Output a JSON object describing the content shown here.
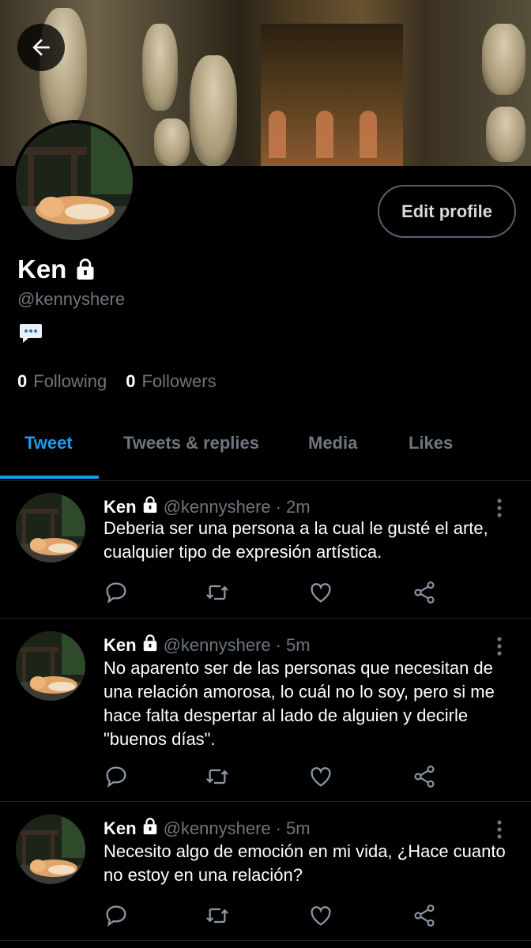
{
  "profile": {
    "name": "Ken",
    "handle": "@kennyshere",
    "edit_label": "Edit profile",
    "following_count": "0",
    "following_label": "Following",
    "followers_count": "0",
    "followers_label": "Followers"
  },
  "tabs": [
    {
      "label": "Tweet",
      "active": true
    },
    {
      "label": "Tweets & replies",
      "active": false
    },
    {
      "label": "Media",
      "active": false
    },
    {
      "label": "Likes",
      "active": false
    }
  ],
  "tweets": [
    {
      "name": "Ken",
      "handle": "@kennyshere",
      "sep": "·",
      "time": "2m",
      "text": "Deberia ser una persona a la cual le gusté el arte, cualquier tipo de expresión artística."
    },
    {
      "name": "Ken",
      "handle": "@kennyshere",
      "sep": "·",
      "time": "5m",
      "text": "No aparento ser de las personas que necesitan de una relación amorosa, lo cuál no lo soy, pero si me hace falta despertar al lado de alguien y decirle \"buenos días\"."
    },
    {
      "name": "Ken",
      "handle": "@kennyshere",
      "sep": "·",
      "time": "5m",
      "text": "Necesito algo de emoción en mi vida, ¿Hace cuanto no estoy en una relación?"
    }
  ],
  "icons": {
    "back": "arrow-left-icon",
    "lock": "lock-icon",
    "bio": "speech-bubble-emoji",
    "reply": "reply-icon",
    "retweet": "retweet-icon",
    "like": "heart-icon",
    "share": "share-icon",
    "more": "more-vertical-icon"
  },
  "colors": {
    "accent": "#1d9bf0",
    "muted": "#6e767d",
    "background": "#000000"
  }
}
